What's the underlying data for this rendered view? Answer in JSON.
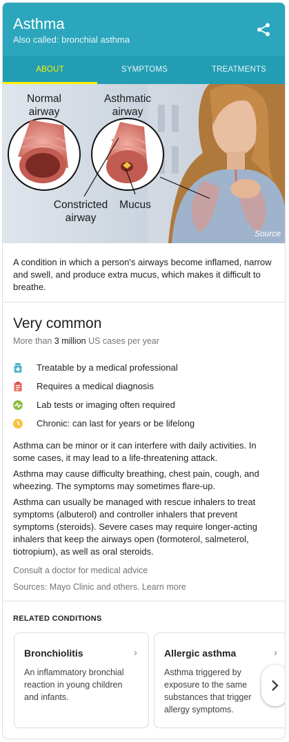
{
  "header": {
    "title": "Asthma",
    "also_called": "Also called: bronchial asthma",
    "accent": "#2ba6bd"
  },
  "tabs": [
    {
      "label": "ABOUT",
      "active": true
    },
    {
      "label": "SYMPTOMS",
      "active": false
    },
    {
      "label": "TREATMENTS",
      "active": false
    }
  ],
  "hero": {
    "labels": {
      "normal": "Normal airway",
      "asthmatic": "Asthmatic airway",
      "constricted": "Constricted airway",
      "mucus": "Mucus"
    },
    "source": "Source"
  },
  "description": "A condition in which a person's airways become inflamed, narrow and swell, and produce extra mucus, which makes it difficult to breathe.",
  "prevalence": {
    "headline": "Very common",
    "prefix": "More than ",
    "count": "3 million",
    "suffix": " US cases per year"
  },
  "facts": [
    {
      "icon": "medicine-bottle-icon",
      "text": "Treatable by a medical professional",
      "color": "#4fb6c7"
    },
    {
      "icon": "clipboard-icon",
      "text": "Requires a medical diagnosis",
      "color": "#e8675b"
    },
    {
      "icon": "pulse-icon",
      "text": "Lab tests or imaging often required",
      "color": "#8bbb3f"
    },
    {
      "icon": "clock-icon",
      "text": "Chronic: can last for years or be lifelong",
      "color": "#f5c342"
    }
  ],
  "paragraphs": [
    "Asthma can be minor or it can interfere with daily activities. In some cases, it may lead to a life-threatening attack.",
    "Asthma may cause difficulty breathing, chest pain, cough, and wheezing. The symptoms may sometimes flare-up.",
    "Asthma can usually be managed with rescue inhalers to treat symptoms (albuterol) and controller inhalers that prevent symptoms (steroids). Severe cases may require longer-acting inhalers that keep the airways open (formoterol, salmeterol, tiotropium), as well as oral steroids."
  ],
  "consult": "Consult a doctor for medical advice",
  "sources": "Sources: Mayo Clinic and others. Learn more",
  "related": {
    "title": "RELATED CONDITIONS",
    "items": [
      {
        "name": "Bronchiolitis",
        "desc": "An inflammatory bronchial reaction in young children and infants."
      },
      {
        "name": "Allergic asthma",
        "desc": "Asthma triggered by exposure to the same substances that trigger allergy symptoms."
      }
    ]
  }
}
